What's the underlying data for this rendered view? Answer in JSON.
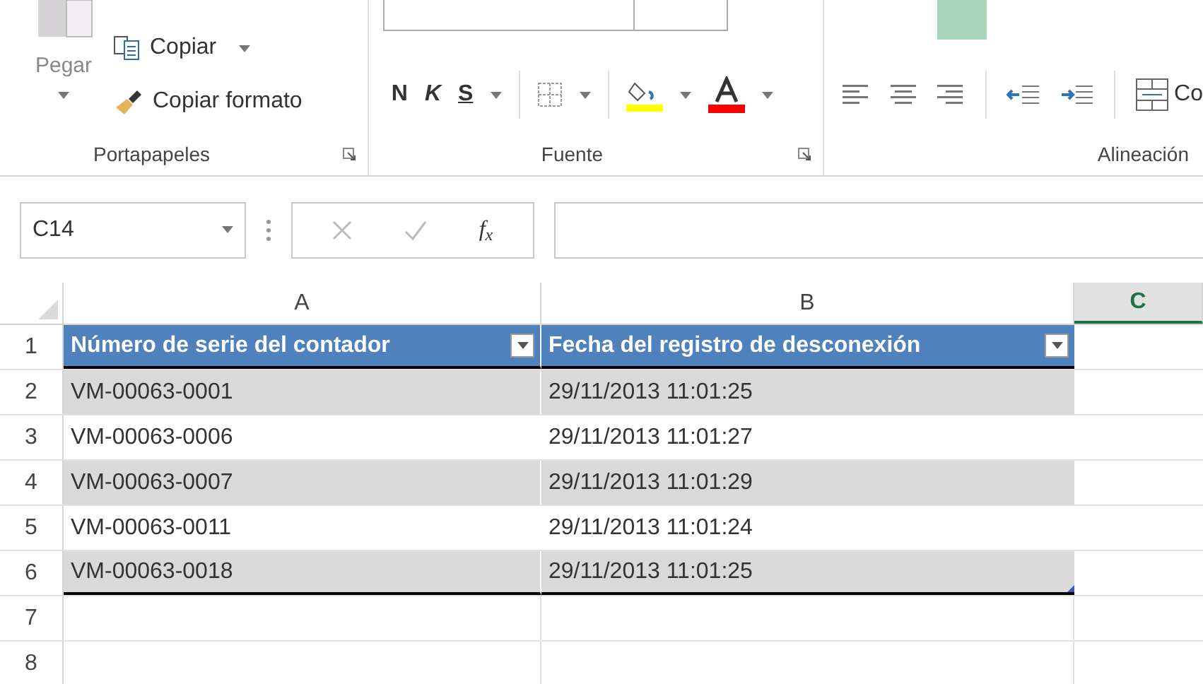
{
  "ribbon": {
    "groups": [
      {
        "label": "Portapapeles",
        "launcher": true
      },
      {
        "label": "Fuente",
        "launcher": true
      },
      {
        "label": "Alineación",
        "launcher": false
      }
    ]
  },
  "clipboard": {
    "paste": "Pegar",
    "copy": "Copiar",
    "format_painter": "Copiar formato"
  },
  "font": {
    "bold": "N",
    "italic": "K",
    "underline": "S"
  },
  "alignment": {
    "merge": "Co"
  },
  "formula_bar": {
    "name_box": "C14",
    "function_label": "f$_{x}$"
  },
  "sheet": {
    "columns": [
      {
        "label": "A",
        "selected": false
      },
      {
        "label": "B",
        "selected": false
      },
      {
        "label": "C",
        "selected": true
      }
    ],
    "rows": [
      {
        "number": "1",
        "kind": "header",
        "cells": [
          "Número de serie del contador",
          "Fecha del registro de desconexión"
        ]
      },
      {
        "number": "2",
        "kind": "data",
        "banded": true,
        "cells": [
          "VM-00063-0001",
          "29/11/2013 11:01:25"
        ]
      },
      {
        "number": "3",
        "kind": "data",
        "banded": false,
        "cells": [
          "VM-00063-0006",
          "29/11/2013 11:01:27"
        ]
      },
      {
        "number": "4",
        "kind": "data",
        "banded": true,
        "cells": [
          "VM-00063-0007",
          "29/11/2013 11:01:29"
        ]
      },
      {
        "number": "5",
        "kind": "data",
        "banded": false,
        "cells": [
          "VM-00063-0011",
          "29/11/2013 11:01:24"
        ]
      },
      {
        "number": "6",
        "kind": "data",
        "banded": true,
        "cells": [
          "VM-00063-0018",
          "29/11/2013 11:01:25"
        ]
      },
      {
        "number": "7",
        "kind": "empty"
      },
      {
        "number": "8",
        "kind": "empty"
      }
    ]
  }
}
